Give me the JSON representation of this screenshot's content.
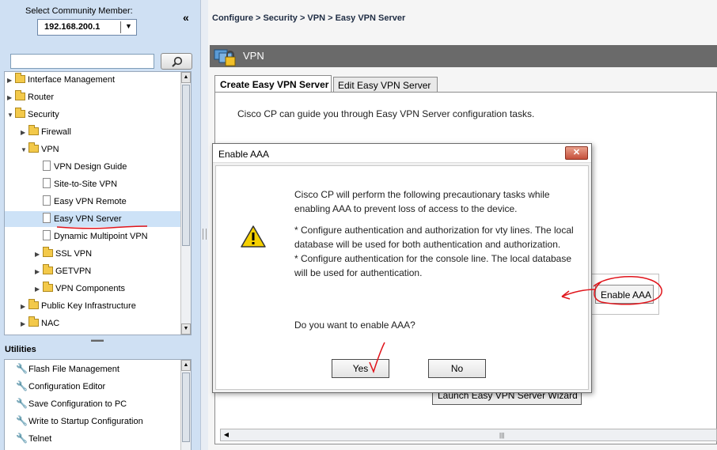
{
  "left_panel": {
    "member_label": "Select Community Member:",
    "member_value": "192.168.200.1",
    "collapse_glyph": "«",
    "search_placeholder": "",
    "tree": [
      {
        "label": "Interface Management",
        "type": "folder",
        "expander": "▶"
      },
      {
        "label": "Router",
        "type": "folder",
        "expander": "▶"
      },
      {
        "label": "Security",
        "type": "folder",
        "expander": "▼"
      },
      {
        "label": "Firewall",
        "type": "folder",
        "expander": "▶"
      },
      {
        "label": "VPN",
        "type": "folder",
        "expander": "▼"
      },
      {
        "label": "VPN Design Guide",
        "type": "page"
      },
      {
        "label": "Site-to-Site VPN",
        "type": "page"
      },
      {
        "label": "Easy VPN Remote",
        "type": "page"
      },
      {
        "label": "Easy VPN Server",
        "type": "page",
        "selected": true
      },
      {
        "label": "Dynamic Multipoint VPN",
        "type": "page"
      },
      {
        "label": "SSL VPN",
        "type": "folder",
        "expander": "▶"
      },
      {
        "label": "GETVPN",
        "type": "folder",
        "expander": "▶"
      },
      {
        "label": "VPN Components",
        "type": "folder",
        "expander": "▶"
      },
      {
        "label": "Public Key Infrastructure",
        "type": "folder",
        "expander": "▶"
      },
      {
        "label": "NAC",
        "type": "folder",
        "expander": "▶"
      }
    ],
    "utilities_title": "Utilities",
    "utilities": [
      "Flash File Management",
      "Configuration Editor",
      "Save Configuration to PC",
      "Write to Startup Configuration",
      "Telnet"
    ]
  },
  "main": {
    "breadcrumb": "Configure > Security > VPN > Easy VPN Server",
    "section_title": "VPN",
    "tabs": [
      {
        "label": "Create Easy VPN Server",
        "active": true
      },
      {
        "label": "Edit Easy VPN Server",
        "active": false
      }
    ],
    "intro_text": "Cisco CP can guide you through Easy VPN Server configuration tasks.",
    "enable_aaa_label": "Enable AAA",
    "wizard_label": "Launch Easy VPN Server Wizard"
  },
  "dialog": {
    "title": "Enable AAA",
    "close_glyph": "✕",
    "line1": "Cisco CP will perform the following precautionary tasks while",
    "line2": "enabling AAA to prevent loss of access to the device.",
    "line3": "* Configure authentication and authorization for vty lines. The local",
    "line4": "database will be used for both authentication and authorization.",
    "line5": "* Configure authentication for the console line. The local database",
    "line6": "will be used for authentication.",
    "question": "Do you want to enable AAA?",
    "yes_label": "Yes",
    "no_label": "No"
  },
  "colors": {
    "left_panel_bg": "#cfe0f3",
    "header_bar": "#6a6a6a",
    "annotation_red": "#e0141b",
    "close_button": "#c5503b"
  }
}
